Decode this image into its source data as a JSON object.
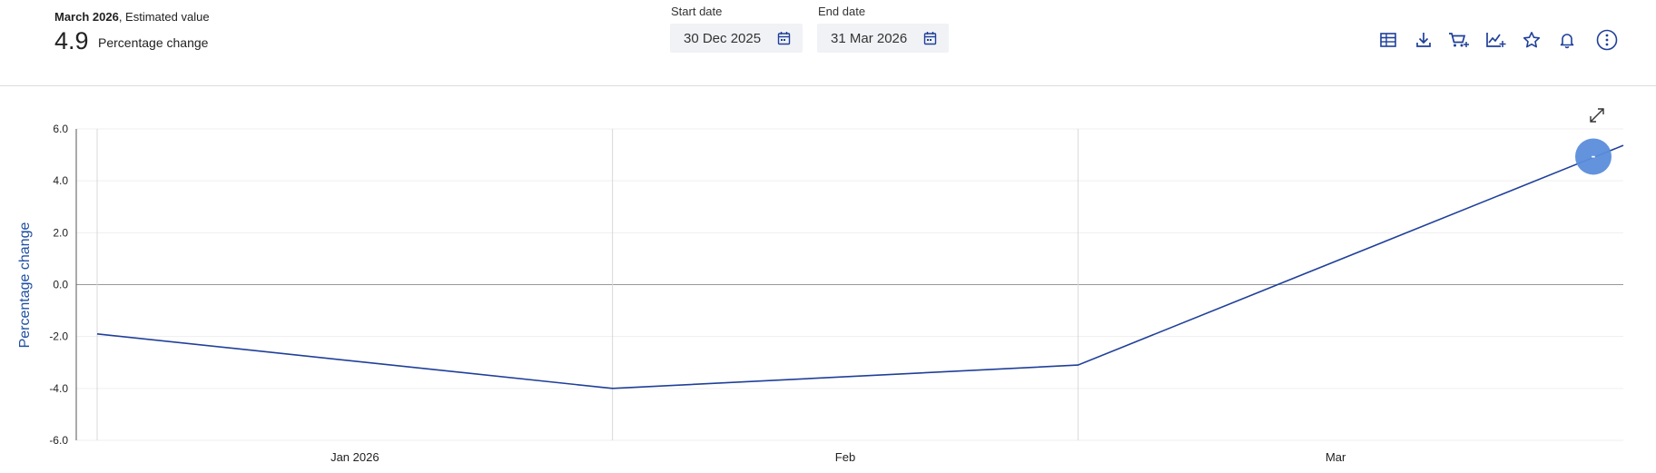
{
  "summary": {
    "period": "March 2026",
    "period_suffix": ", Estimated value",
    "value": "4.9",
    "label": "Percentage change"
  },
  "filters": {
    "start": {
      "label": "Start date",
      "value": "30 Dec 2025"
    },
    "end": {
      "label": "End date",
      "value": "31 Mar 2026"
    }
  },
  "toolbar": {
    "icons": [
      "table-icon",
      "download-icon",
      "add-to-cart-icon",
      "chart-add-icon",
      "star-icon",
      "bell-icon",
      "more-vertical-icon"
    ]
  },
  "marker_label": "-",
  "chart_data": {
    "type": "line",
    "ylabel": "Percentage change",
    "ylim": [
      -6.0,
      6.0
    ],
    "y_ticks": [
      "6.0",
      "4.0",
      "2.0",
      "0.0",
      "-2.0",
      "-4.0",
      "-6.0"
    ],
    "x_tick_labels": [
      "Jan 2026",
      "Feb",
      "Mar"
    ],
    "grid": true,
    "series": [
      {
        "color": "#1f3f99",
        "points": [
          {
            "x": "2025-12-31",
            "y": -1.9
          },
          {
            "x": "2026-01-31",
            "y": -4.0
          },
          {
            "x": "2026-02-28",
            "y": -3.1
          },
          {
            "x": "2026-03-31",
            "y": 4.9
          }
        ]
      }
    ]
  }
}
